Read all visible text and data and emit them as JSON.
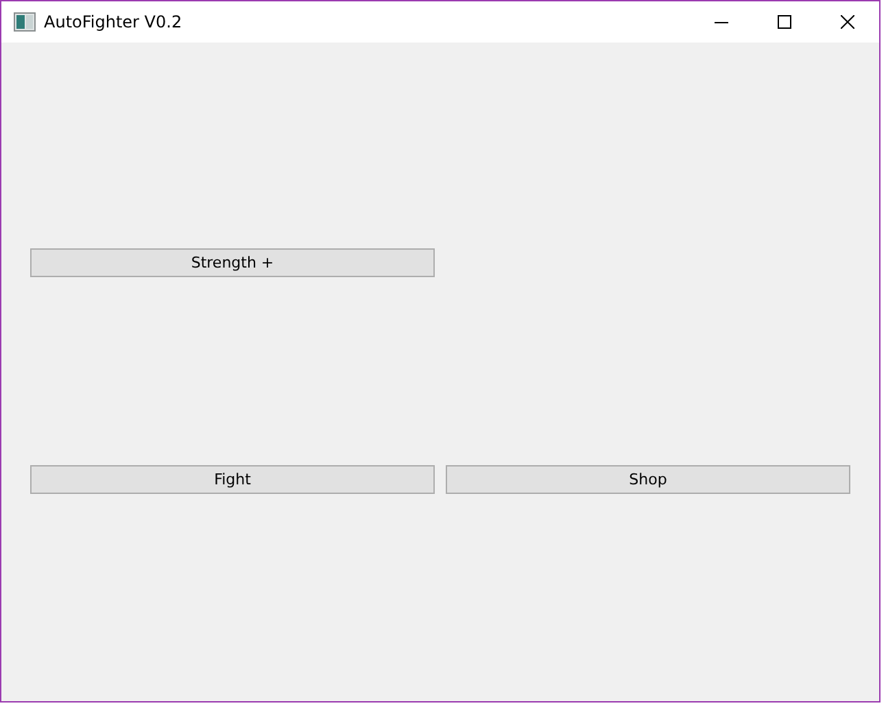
{
  "window": {
    "title": "AutoFighter V0.2"
  },
  "button_rows": [
    {
      "buttons": [
        {
          "label": "Strength +"
        }
      ]
    },
    {
      "buttons": [
        {
          "label": "Fight"
        },
        {
          "label": "Shop"
        }
      ]
    }
  ]
}
